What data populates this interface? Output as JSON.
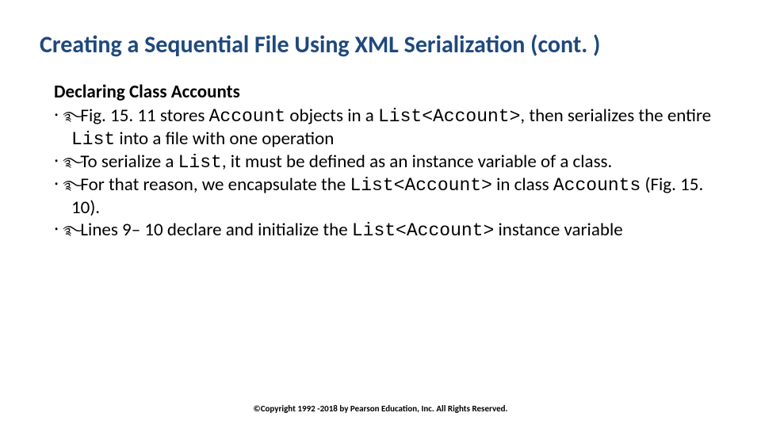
{
  "title": "Creating a Sequential File Using XML Serialization (cont. )",
  "subheading": "Declaring Class Accounts",
  "bullet_glyph": "࿐",
  "bullets": [
    {
      "pre1": "Fig. 15. 11 stores ",
      "code1": "Account",
      "mid1": " objects in a ",
      "code2": "List<Account>",
      "mid2": ", then serializes the entire ",
      "code3": "List",
      "post": " into a file with one operation"
    },
    {
      "pre1": "To serialize a ",
      "code1": "List",
      "mid1": ", it must be defined as an instance variable of a class.",
      "code2": "",
      "mid2": "",
      "code3": "",
      "post": ""
    },
    {
      "pre1": "For that reason, we encapsulate the ",
      "code1": "List<Account>",
      "mid1": "  in class ",
      "code2": "Accounts",
      "mid2": " (Fig. 15. 10).",
      "code3": "",
      "post": ""
    },
    {
      "pre1": "Lines 9– 10 declare and initialize the ",
      "code1": "List<Account>",
      "mid1": " instance variable",
      "code2": "",
      "mid2": "",
      "code3": "",
      "post": ""
    }
  ],
  "footer": "©Copyright 1992 -2018 by Pearson Education, Inc. All Rights Reserved."
}
